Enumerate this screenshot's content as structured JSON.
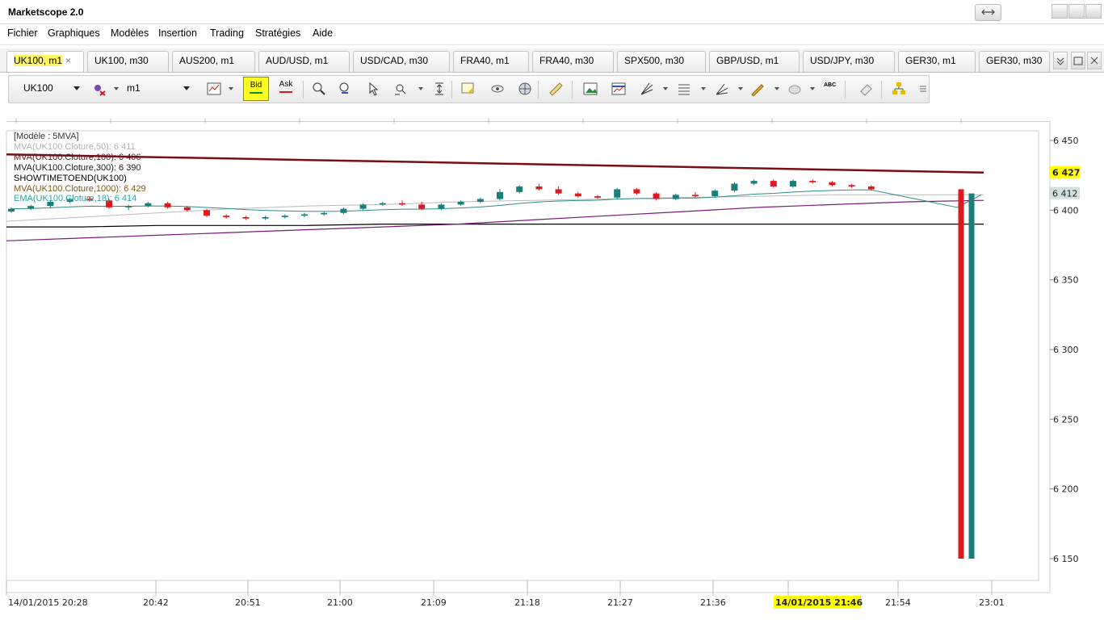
{
  "window": {
    "title": "Marketscope 2.0"
  },
  "menu": [
    "Fichier",
    "Graphiques",
    "Modèles",
    "Insertion",
    "Trading",
    "Stratégies",
    "Aide"
  ],
  "tabs": [
    {
      "label": "UK100, m1",
      "active": true
    },
    {
      "label": "UK100, m30"
    },
    {
      "label": "AUS200, m1"
    },
    {
      "label": "AUD/USD, m1"
    },
    {
      "label": "USD/CAD, m30"
    },
    {
      "label": "FRA40, m1"
    },
    {
      "label": "FRA40, m30"
    },
    {
      "label": "SPX500, m30"
    },
    {
      "label": "GBP/USD, m1"
    },
    {
      "label": "USD/JPY, m30"
    },
    {
      "label": "GER30, m1"
    },
    {
      "label": "GER30, m30"
    }
  ],
  "tab_close": "×",
  "toolbar": {
    "instrument": "UK100",
    "timeframe": "m1",
    "bid_label": "Bid",
    "ask_label": "Ask",
    "abc_label": "ABC"
  },
  "legend": [
    {
      "text": "[Modèle : 5MVA]",
      "color": "#333333"
    },
    {
      "text": "MVA(UK100.Cloture,50): 6 411",
      "color": "#b3b3b3"
    },
    {
      "text": "MVA(UK100.Cloture,100): 6 406",
      "color": "#5a1a20"
    },
    {
      "text": "MVA(UK100.Cloture,300): 6 390",
      "color": "#1a1a1a"
    },
    {
      "text": "SHOWTIMETOEND(UK100)",
      "color": "#000000"
    },
    {
      "text": "MVA(UK100.Cloture,1000): 6 429",
      "color": "#7a5a1a"
    },
    {
      "text": "EMA(UK100.Cloture,18): 6 414",
      "color": "#2aa2a2"
    }
  ],
  "price_axis": {
    "ticks": [
      "6 450",
      "6 400",
      "6 350",
      "6 300",
      "6 250",
      "6 200",
      "6 150"
    ],
    "tick_values": [
      6450,
      6400,
      6350,
      6300,
      6250,
      6200,
      6150
    ],
    "marker_1000": "6 427",
    "marker_bid": "6 412"
  },
  "time_axis": {
    "labels": [
      "14/01/2015 20:28",
      "20:42",
      "20:51",
      "21:00",
      "21:09",
      "21:18",
      "21:27",
      "21:36",
      "14/01/2015 21:46",
      "21:54",
      "23:01"
    ],
    "highlight_index": 8
  },
  "colors": {
    "bull": "#1a7e7a",
    "bear": "#dd1a1f",
    "mva1000": "#7a0f12",
    "mva300": "#000000",
    "mva100": "#7a1a78",
    "mva50": "#bbbbbb",
    "ema18": "#2a8f8b",
    "highlight": "#ffff00"
  },
  "chart_data": {
    "type": "candlestick",
    "title": "",
    "xlabel": "",
    "ylabel": "",
    "ylim": [
      6140,
      6460
    ],
    "times": [
      "20:28",
      "20:30",
      "20:32",
      "20:34",
      "20:36",
      "20:38",
      "20:40",
      "20:42",
      "20:44",
      "20:46",
      "20:48",
      "20:50",
      "20:52",
      "20:54",
      "20:56",
      "20:58",
      "21:00",
      "21:02",
      "21:04",
      "21:06",
      "21:08",
      "21:10",
      "21:12",
      "21:14",
      "21:16",
      "21:18",
      "21:20",
      "21:22",
      "21:24",
      "21:26",
      "21:28",
      "21:30",
      "21:32",
      "21:34",
      "21:36",
      "21:38",
      "21:40",
      "21:42",
      "21:44",
      "21:46",
      "21:48",
      "21:50",
      "21:52",
      "21:54",
      "21:56",
      "21:58",
      "22:00"
    ],
    "candles": [
      [
        6399,
        6402,
        6398,
        6401
      ],
      [
        6401,
        6404,
        6400,
        6403
      ],
      [
        6403,
        6407,
        6402,
        6406
      ],
      [
        6406,
        6409,
        6405,
        6408
      ],
      [
        6408,
        6410,
        6406,
        6407
      ],
      [
        6407,
        6408,
        6401,
        6402
      ],
      [
        6402,
        6404,
        6400,
        6403
      ],
      [
        6403,
        6406,
        6402,
        6405
      ],
      [
        6405,
        6406,
        6401,
        6402
      ],
      [
        6402,
        6403,
        6399,
        6400
      ],
      [
        6400,
        6401,
        6395,
        6396
      ],
      [
        6396,
        6397,
        6394,
        6395
      ],
      [
        6395,
        6396,
        6393,
        6394
      ],
      [
        6394,
        6396,
        6393,
        6395
      ],
      [
        6395,
        6397,
        6394,
        6396
      ],
      [
        6396,
        6398,
        6395,
        6397
      ],
      [
        6397,
        6399,
        6396,
        6398
      ],
      [
        6398,
        6402,
        6397,
        6401
      ],
      [
        6401,
        6405,
        6400,
        6404
      ],
      [
        6404,
        6406,
        6403,
        6405
      ],
      [
        6405,
        6407,
        6403,
        6404
      ],
      [
        6404,
        6406,
        6400,
        6401
      ],
      [
        6401,
        6405,
        6400,
        6404
      ],
      [
        6404,
        6407,
        6403,
        6406
      ],
      [
        6406,
        6409,
        6405,
        6408
      ],
      [
        6408,
        6415,
        6407,
        6413
      ],
      [
        6413,
        6418,
        6412,
        6417
      ],
      [
        6417,
        6419,
        6414,
        6415
      ],
      [
        6415,
        6417,
        6411,
        6412
      ],
      [
        6412,
        6413,
        6409,
        6410
      ],
      [
        6410,
        6411,
        6408,
        6409
      ],
      [
        6409,
        6416,
        6408,
        6415
      ],
      [
        6415,
        6416,
        6411,
        6412
      ],
      [
        6412,
        6413,
        6407,
        6408
      ],
      [
        6408,
        6412,
        6407,
        6411
      ],
      [
        6411,
        6413,
        6409,
        6410
      ],
      [
        6410,
        6415,
        6409,
        6414
      ],
      [
        6414,
        6420,
        6413,
        6419
      ],
      [
        6419,
        6422,
        6418,
        6421
      ],
      [
        6421,
        6422,
        6416,
        6417
      ],
      [
        6417,
        6422,
        6416,
        6421
      ],
      [
        6421,
        6422,
        6419,
        6420
      ],
      [
        6420,
        6421,
        6417,
        6418
      ],
      [
        6418,
        6419,
        6416,
        6417
      ],
      [
        6417,
        6418,
        6414,
        6415
      ],
      [
        6415,
        6416,
        6150,
        6150
      ],
      [
        6150,
        6413,
        6150,
        6412
      ]
    ],
    "series": [
      {
        "name": "MVA(UK100.Cloture,1000)",
        "values": [
          6440,
          6439,
          6438,
          6437,
          6436,
          6435,
          6434,
          6433,
          6432,
          6431,
          6430,
          6429,
          6428,
          6427
        ]
      },
      {
        "name": "MVA(UK100.Cloture,300)",
        "values": [
          6388,
          6388,
          6389,
          6389,
          6389,
          6390,
          6390,
          6390,
          6390,
          6390,
          6390,
          6390,
          6390,
          6390
        ]
      },
      {
        "name": "MVA(UK100.Cloture,100)",
        "values": [
          6378,
          6380,
          6382,
          6384,
          6386,
          6388,
          6390,
          6393,
          6396,
          6399,
          6402,
          6404,
          6406,
          6407
        ]
      },
      {
        "name": "MVA(UK100.Cloture,50)",
        "values": [
          6392,
          6395,
          6398,
          6401,
          6403,
          6404,
          6406,
          6407,
          6408,
          6409,
          6410,
          6411,
          6411,
          6411
        ]
      }
    ]
  }
}
